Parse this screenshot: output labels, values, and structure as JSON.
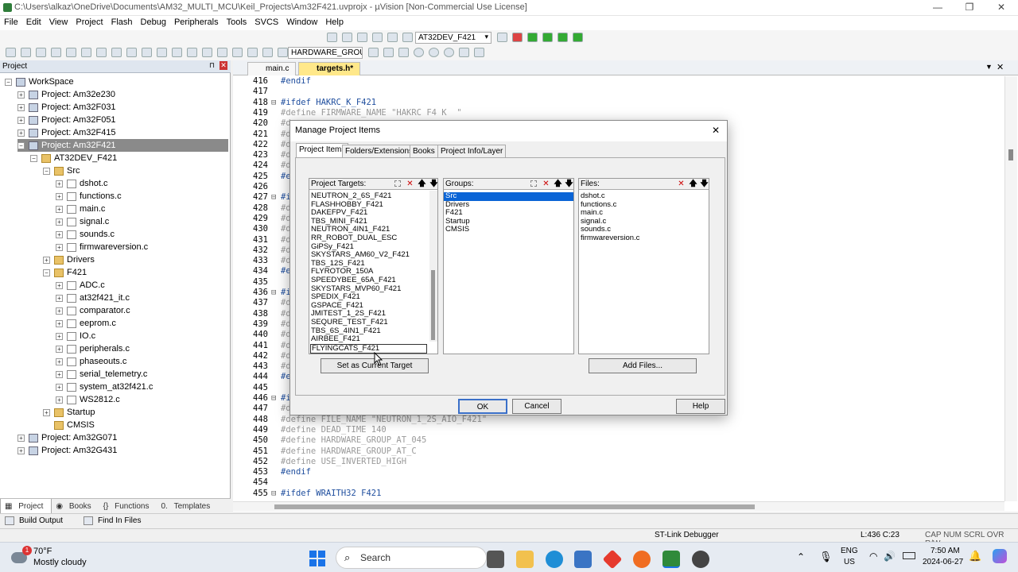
{
  "window": {
    "title": "C:\\Users\\alkaz\\OneDrive\\Documents\\AM32_MULTI_MCU\\Keil_Projects\\Am32F421.uvprojx - µVision  [Non-Commercial Use License]",
    "minimize": "—",
    "maximize": "❐",
    "close": "✕"
  },
  "menu": [
    "File",
    "Edit",
    "View",
    "Project",
    "Flash",
    "Debug",
    "Peripherals",
    "Tools",
    "SVCS",
    "Window",
    "Help"
  ],
  "toolbar": {
    "target_select": "AT32DEV_F421",
    "group_select": "HARDWARE_GROUI"
  },
  "project_panel": {
    "title": "Project",
    "pin": "⊓",
    "close": "✕",
    "workspace": "WorkSpace",
    "projects_top": [
      "Project: Am32e230",
      "Project: Am32F031",
      "Project: Am32F051",
      "Project: Am32F415"
    ],
    "selected_project": "Project: Am32F421",
    "target": "AT32DEV_F421",
    "src_group": "Src",
    "src_files": [
      "dshot.c",
      "functions.c",
      "main.c",
      "signal.c",
      "sounds.c",
      "firmwareversion.c"
    ],
    "drivers_group": "Drivers",
    "f421_group": "F421",
    "f421_files": [
      "ADC.c",
      "at32f421_it.c",
      "comparator.c",
      "eeprom.c",
      "IO.c",
      "peripherals.c",
      "phaseouts.c",
      "serial_telemetry.c",
      "system_at32f421.c",
      "WS2812.c"
    ],
    "startup_group": "Startup",
    "cmsis_group": "CMSIS",
    "projects_bottom": [
      "Project: Am32G071",
      "Project: Am32G431"
    ],
    "tabs": [
      "Project",
      "Books",
      "Functions",
      "Templates"
    ]
  },
  "editor": {
    "tabs": [
      "main.c",
      "targets.h*"
    ],
    "lines": [
      {
        "n": "416",
        "g": "",
        "t": "#endif",
        "c": "pp"
      },
      {
        "n": "417",
        "g": "",
        "t": "",
        "c": ""
      },
      {
        "n": "418",
        "g": "⊟",
        "t": "#ifdef HAKRC_K_F421",
        "c": "pp"
      },
      {
        "n": "419",
        "g": "",
        "t": "#define FIRMWARE_NAME \"HAKRC F4 K  \"",
        "c": "gray"
      },
      {
        "n": "420",
        "g": "",
        "t": "#d",
        "c": "gray"
      },
      {
        "n": "421",
        "g": "",
        "t": "#d",
        "c": "gray"
      },
      {
        "n": "422",
        "g": "",
        "t": "#d",
        "c": "gray"
      },
      {
        "n": "423",
        "g": "",
        "t": "#d",
        "c": "gray"
      },
      {
        "n": "424",
        "g": "",
        "t": "#d",
        "c": "gray"
      },
      {
        "n": "425",
        "g": "",
        "t": "#e",
        "c": "pp"
      },
      {
        "n": "426",
        "g": "",
        "t": "",
        "c": ""
      },
      {
        "n": "427",
        "g": "⊟",
        "t": "#i",
        "c": "pp"
      },
      {
        "n": "428",
        "g": "",
        "t": "#d",
        "c": "gray"
      },
      {
        "n": "429",
        "g": "",
        "t": "#d",
        "c": "gray"
      },
      {
        "n": "430",
        "g": "",
        "t": "#d",
        "c": "gray"
      },
      {
        "n": "431",
        "g": "",
        "t": "#d",
        "c": "gray"
      },
      {
        "n": "432",
        "g": "",
        "t": "#d",
        "c": "gray"
      },
      {
        "n": "433",
        "g": "",
        "t": "#d",
        "c": "gray"
      },
      {
        "n": "434",
        "g": "",
        "t": "#e",
        "c": "pp"
      },
      {
        "n": "435",
        "g": "",
        "t": "",
        "c": ""
      },
      {
        "n": "436",
        "g": "⊟",
        "t": "#i",
        "c": "pp"
      },
      {
        "n": "437",
        "g": "",
        "t": "#d",
        "c": "gray"
      },
      {
        "n": "438",
        "g": "",
        "t": "#d",
        "c": "gray"
      },
      {
        "n": "439",
        "g": "",
        "t": "#d",
        "c": "gray"
      },
      {
        "n": "440",
        "g": "",
        "t": "#d",
        "c": "gray"
      },
      {
        "n": "441",
        "g": "",
        "t": "#d",
        "c": "gray"
      },
      {
        "n": "442",
        "g": "",
        "t": "#d",
        "c": "gray"
      },
      {
        "n": "443",
        "g": "",
        "t": "#d",
        "c": "gray"
      },
      {
        "n": "444",
        "g": "",
        "t": "#e",
        "c": "pp"
      },
      {
        "n": "445",
        "g": "",
        "t": "",
        "c": ""
      },
      {
        "n": "446",
        "g": "⊟",
        "t": "#i",
        "c": "pp"
      },
      {
        "n": "447",
        "g": "",
        "t": "#d",
        "c": "gray"
      },
      {
        "n": "448",
        "g": "",
        "t": "#define FILE_NAME \"NEUTRON_1_2S_AIO_F421\"",
        "c": "gray"
      },
      {
        "n": "449",
        "g": "",
        "t": "#define DEAD_TIME 140",
        "c": "gray"
      },
      {
        "n": "450",
        "g": "",
        "t": "#define HARDWARE_GROUP_AT_045",
        "c": "gray"
      },
      {
        "n": "451",
        "g": "",
        "t": "#define HARDWARE_GROUP_AT_C",
        "c": "gray"
      },
      {
        "n": "452",
        "g": "",
        "t": "#define USE_INVERTED_HIGH",
        "c": "gray"
      },
      {
        "n": "453",
        "g": "",
        "t": "#endif",
        "c": "pp"
      },
      {
        "n": "454",
        "g": "",
        "t": "",
        "c": ""
      },
      {
        "n": "455",
        "g": "⊟",
        "t": "#ifdef WRAITH32 F421",
        "c": "pp"
      }
    ]
  },
  "dialog": {
    "title": "Manage Project Items",
    "close": "✕",
    "tabs": [
      "Project Items",
      "Folders/Extensions",
      "Books",
      "Project Info/Layer"
    ],
    "targets_label": "Project Targets:",
    "targets": [
      "NEUTRON_2_6S_F421",
      "FLASHHOBBY_F421",
      "DAKEFPV_F421",
      "TBS_MINI_F421",
      "NEUTRON_4IN1_F421",
      "RR_ROBOT_DUAL_ESC",
      "GiPSy_F421",
      "SKYSTARS_AM60_V2_F421",
      "TBS_12S_F421",
      "FLYROTOR_150A",
      "SPEEDYBEE_65A_F421",
      "SKYSTARS_MVP60_F421",
      "SPEDIX_F421",
      "GSPACE_F421",
      "JMITEST_1_2S_F421",
      "SEQURE_TEST_F421",
      "TBS_6S_4IN1_F421",
      "AIRBEE_F421"
    ],
    "editing_target": "FLYINGCATS_F421",
    "groups_label": "Groups:",
    "groups": [
      "Src",
      "Drivers",
      "F421",
      "Startup",
      "CMSIS"
    ],
    "files_label": "Files:",
    "files": [
      "dshot.c",
      "functions.c",
      "main.c",
      "signal.c",
      "sounds.c",
      "firmwareversion.c"
    ],
    "set_target_btn": "Set as Current Target",
    "add_files_btn": "Add Files...",
    "ok_btn": "OK",
    "cancel_btn": "Cancel",
    "help_btn": "Help"
  },
  "output_tabs": [
    "Build Output",
    "Find In Files"
  ],
  "status": {
    "debugger": "ST-Link Debugger",
    "position": "L:436 C:23",
    "indicators": "CAP  NUM  SCRL  OVR  R/W"
  },
  "taskbar": {
    "weather_temp": "70°F",
    "weather_desc": "Mostly cloudy",
    "weather_badge": "1",
    "search_placeholder": "Search",
    "lang_top": "ENG",
    "lang_bottom": "US",
    "time": "7:50 AM",
    "date": "2024-06-27"
  }
}
